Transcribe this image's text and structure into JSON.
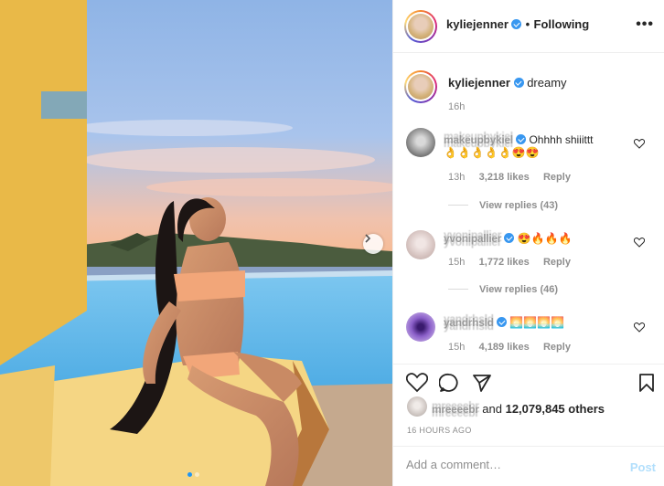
{
  "post": {
    "author": "kyliejenner",
    "follow_status": "Following",
    "more": "•••",
    "separator": "•",
    "caption": "dreamy",
    "caption_time": "16h",
    "carousel": {
      "slide_index": 1,
      "slide_count": 2
    },
    "likes_text": "and",
    "likes_count": "12,079,845 others",
    "time_ago": "16 HOURS AGO"
  },
  "comments": [
    {
      "username": "makeupbykiel",
      "text": "Ohhhh shiiittt",
      "emoji": "👌👌👌👌👌😍😍",
      "time": "13h",
      "likes": "3,218 likes",
      "reply": "Reply",
      "view_replies": "View replies (43)"
    },
    {
      "username": "yvonipallier",
      "text": "😍🔥🔥🔥",
      "time": "15h",
      "likes": "1,772 likes",
      "reply": "Reply",
      "view_replies": "View replies (46)"
    },
    {
      "username": "yandrhsld",
      "text": "🌅🌅🌅🌅",
      "time": "15h",
      "likes": "4,189 likes",
      "reply": "Reply"
    }
  ],
  "liked_by": "mreeeebr",
  "add_comment": {
    "placeholder": "Add a comment…",
    "post_label": "Post"
  },
  "colors": {
    "verified": "#3897f0",
    "post_button": "#b2dffc",
    "secondary_text": "#8e8e8e"
  },
  "icons": [
    "heart-icon",
    "comment-icon",
    "share-icon",
    "bookmark-icon",
    "chevron-right-icon",
    "more-icon",
    "verified-icon"
  ]
}
